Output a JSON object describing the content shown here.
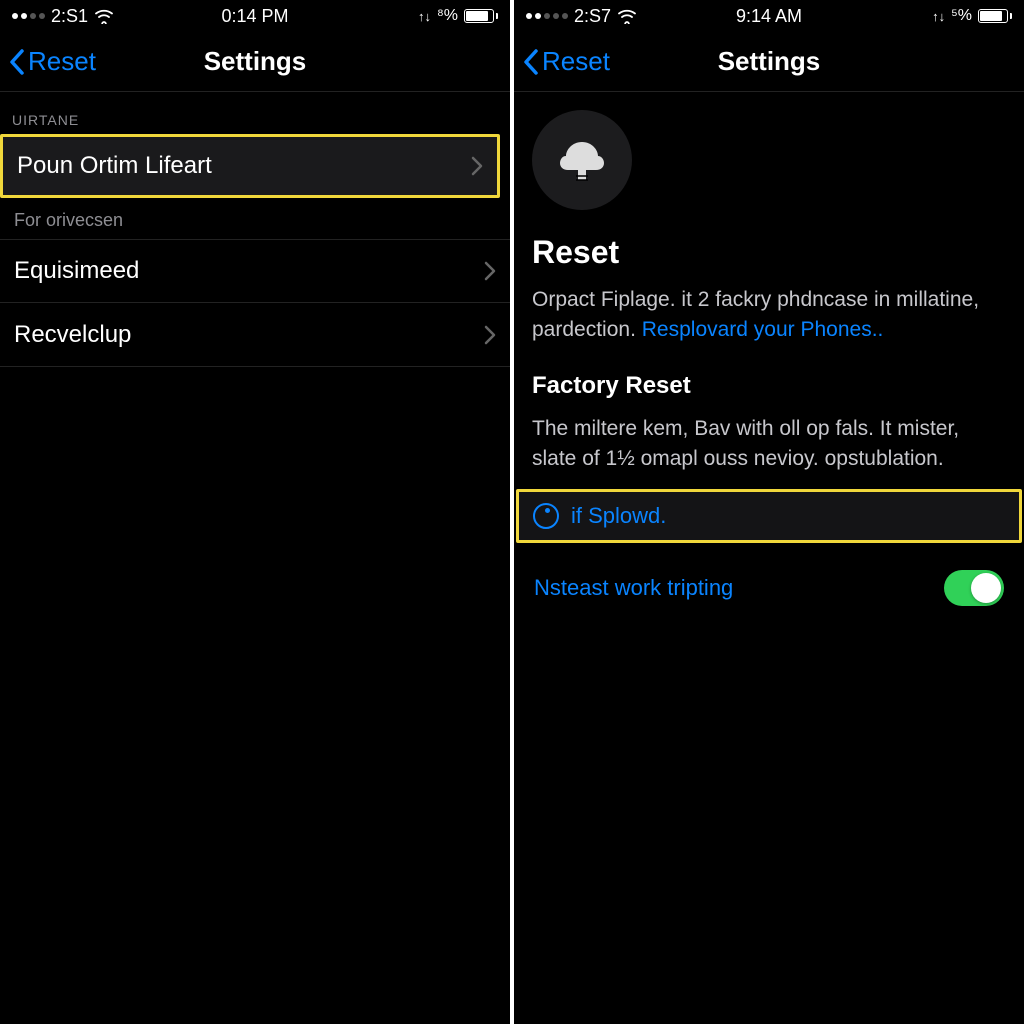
{
  "left": {
    "status": {
      "carrier_time": "2:S1",
      "clock": "0:14 PM",
      "battery_text": "⁸%"
    },
    "nav": {
      "back": "Reset",
      "title": "Settings"
    },
    "section_label": "UIRTANE",
    "rows": [
      {
        "label": "Poun Ortim Lifeart"
      },
      {
        "label": "Equisimeed"
      },
      {
        "label": "Recvelclup"
      }
    ],
    "footer": "For orivecsen"
  },
  "right": {
    "status": {
      "carrier_time": "2:S7",
      "clock": "9:14 AM",
      "battery_text": "⁵%"
    },
    "nav": {
      "back": "Reset",
      "title": "Settings"
    },
    "info": {
      "title": "Reset",
      "desc_plain": "Orpact Fiplage. it 2 fackry phdncase in millatine, pardection. ",
      "desc_link": "Resplovard your Phones..",
      "sub_title": "Factory Reset",
      "sub_desc": "The miltere kem, Bav with oll op fals. It mister, slate of 1½ omapl ouss nevioy. opstublation."
    },
    "action": "if Splowd.",
    "toggle_label": "Nsteast work tripting"
  }
}
